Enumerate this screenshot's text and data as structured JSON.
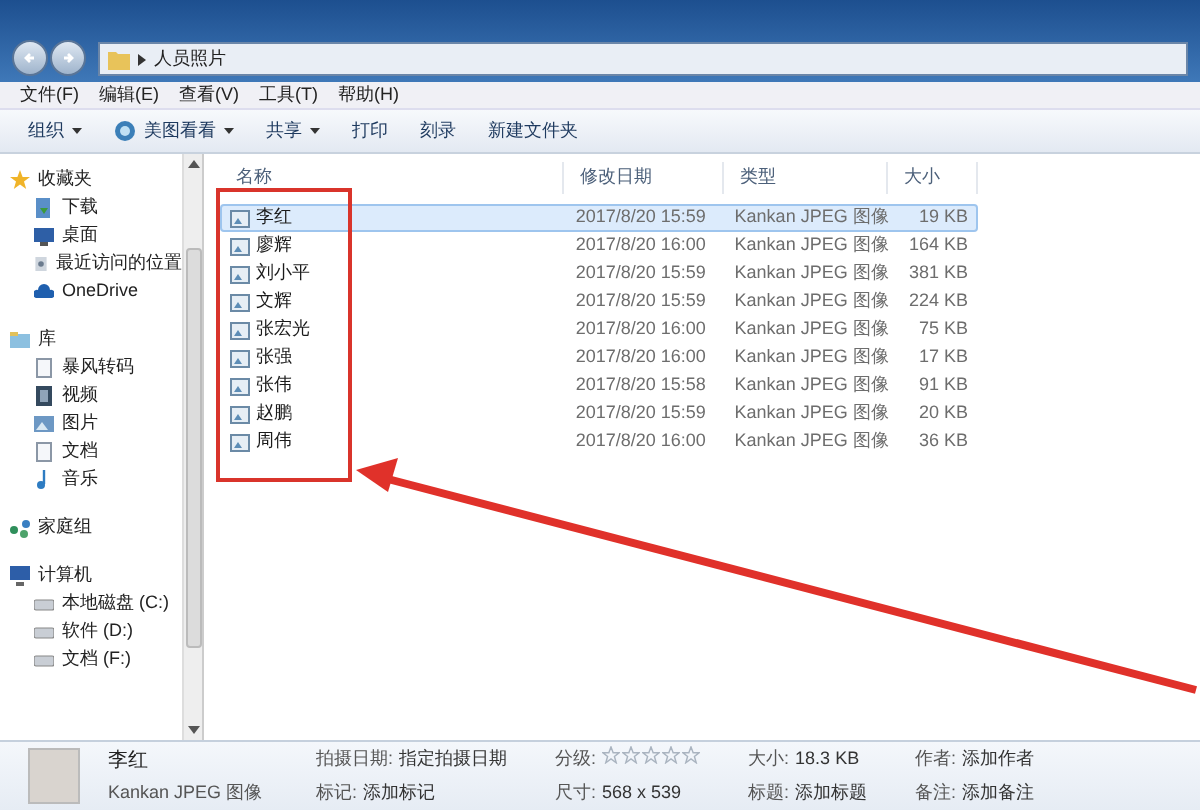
{
  "window": {
    "breadcrumb": "人员照片"
  },
  "menu": [
    "文件(F)",
    "编辑(E)",
    "查看(V)",
    "工具(T)",
    "帮助(H)"
  ],
  "toolbar": [
    {
      "label": "组织",
      "kind": "dropdown"
    },
    {
      "label": "美图看看",
      "kind": "app"
    },
    {
      "label": "共享",
      "kind": "dropdown"
    },
    {
      "label": "打印",
      "kind": "plain"
    },
    {
      "label": "刻录",
      "kind": "plain"
    },
    {
      "label": "新建文件夹",
      "kind": "plain"
    }
  ],
  "sidebar": [
    {
      "label": "收藏夹",
      "kind": "star",
      "children": [
        {
          "label": "下载",
          "kind": "download"
        },
        {
          "label": "桌面",
          "kind": "desktop"
        },
        {
          "label": "最近访问的位置",
          "kind": "recent"
        },
        {
          "label": "OneDrive",
          "kind": "cloud"
        }
      ]
    },
    {
      "label": "库",
      "kind": "library",
      "children": [
        {
          "label": "暴风转码",
          "kind": "doc"
        },
        {
          "label": "视频",
          "kind": "video"
        },
        {
          "label": "图片",
          "kind": "picture"
        },
        {
          "label": "文档",
          "kind": "doc"
        },
        {
          "label": "音乐",
          "kind": "music"
        }
      ]
    },
    {
      "label": "家庭组",
      "kind": "homegroup"
    },
    {
      "label": "计算机",
      "kind": "computer",
      "children": [
        {
          "label": "本地磁盘 (C:)",
          "kind": "drive"
        },
        {
          "label": "软件 (D:)",
          "kind": "drive"
        },
        {
          "label": "文档 (F:)",
          "kind": "drive"
        }
      ]
    }
  ],
  "table": {
    "columns": [
      "名称",
      "修改日期",
      "类型",
      "大小"
    ],
    "rows": [
      {
        "name": "李红",
        "date": "2017/8/20 15:59",
        "type": "Kankan JPEG 图像",
        "size": "19 KB",
        "selected": true
      },
      {
        "name": "廖辉",
        "date": "2017/8/20 16:00",
        "type": "Kankan JPEG 图像",
        "size": "164 KB",
        "selected": false
      },
      {
        "name": "刘小平",
        "date": "2017/8/20 15:59",
        "type": "Kankan JPEG 图像",
        "size": "381 KB",
        "selected": false
      },
      {
        "name": "文辉",
        "date": "2017/8/20 15:59",
        "type": "Kankan JPEG 图像",
        "size": "224 KB",
        "selected": false
      },
      {
        "name": "张宏光",
        "date": "2017/8/20 16:00",
        "type": "Kankan JPEG 图像",
        "size": "75 KB",
        "selected": false
      },
      {
        "name": "张强",
        "date": "2017/8/20 16:00",
        "type": "Kankan JPEG 图像",
        "size": "17 KB",
        "selected": false
      },
      {
        "name": "张伟",
        "date": "2017/8/20 15:58",
        "type": "Kankan JPEG 图像",
        "size": "91 KB",
        "selected": false
      },
      {
        "name": "赵鹏",
        "date": "2017/8/20 15:59",
        "type": "Kankan JPEG 图像",
        "size": "20 KB",
        "selected": false
      },
      {
        "name": "周伟",
        "date": "2017/8/20 16:00",
        "type": "Kankan JPEG 图像",
        "size": "36 KB",
        "selected": false
      }
    ]
  },
  "details": {
    "name": "李红",
    "type": "Kankan JPEG 图像",
    "stars": 0,
    "fields": [
      {
        "label": "拍摄日期:",
        "value": "指定拍摄日期"
      },
      {
        "label": "标记:",
        "value": "添加标记"
      },
      {
        "label": "分级:",
        "kind": "rating"
      },
      {
        "label": "尺寸:",
        "value": "568 x 539"
      },
      {
        "label": "大小:",
        "value": "18.3 KB"
      },
      {
        "label": "标题:",
        "value": "添加标题"
      },
      {
        "label": "作者:",
        "value": "添加作者"
      },
      {
        "label": "备注:",
        "value": "添加备注"
      }
    ]
  }
}
